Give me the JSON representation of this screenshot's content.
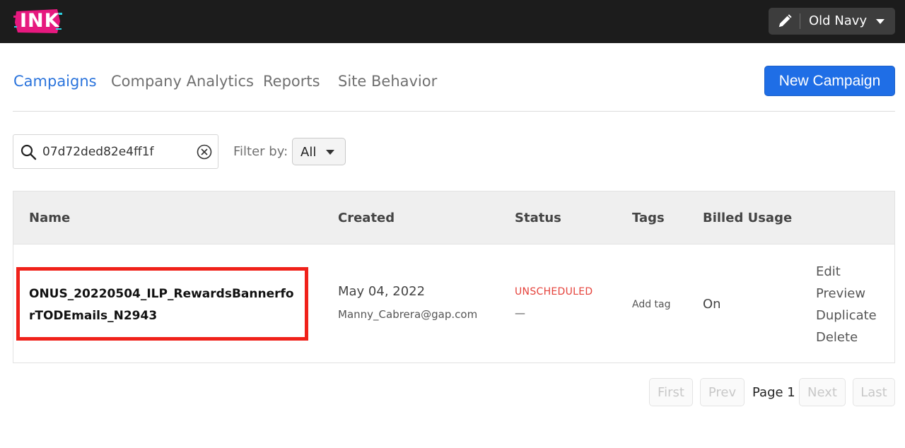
{
  "app": {
    "logo_text": "INK"
  },
  "account": {
    "name": "Old Navy"
  },
  "nav": {
    "tabs": [
      {
        "label": "Campaigns",
        "active": true
      },
      {
        "label": "Company Analytics",
        "active": false
      },
      {
        "label": "Reports",
        "active": false
      },
      {
        "label": "Site Behavior",
        "active": false
      }
    ],
    "new_campaign_label": "New Campaign"
  },
  "search": {
    "value": "07d72ded82e4ff1f",
    "placeholder": ""
  },
  "filter": {
    "label": "Filter by:",
    "selected": "All"
  },
  "table": {
    "columns": [
      "Name",
      "Created",
      "Status",
      "Tags",
      "Billed Usage"
    ],
    "rows": [
      {
        "name": "ONUS_20220504_ILP_RewardsBannerforTODEmails_N2943",
        "created_date": "May 04, 2022",
        "created_by": "Manny_Cabrera@gap.com",
        "status": "UNSCHEDULED",
        "status_sub": "—",
        "tags_action": "Add tag",
        "billed_usage": "On",
        "actions": [
          "Edit",
          "Preview",
          "Duplicate",
          "Delete"
        ]
      }
    ]
  },
  "pagination": {
    "first": "First",
    "prev": "Prev",
    "page_label": "Page 1",
    "next": "Next",
    "last": "Last"
  },
  "colors": {
    "topbar": "#1c1c1c",
    "accent": "#1f6ee6",
    "active_tab": "#2b74dc",
    "status_unscheduled": "#e5423b",
    "highlight_box": "#f0211a",
    "logo_pink": "#e6197f"
  },
  "icons": [
    "pencil-icon",
    "chevron-down-icon",
    "search-icon",
    "clear-icon"
  ]
}
